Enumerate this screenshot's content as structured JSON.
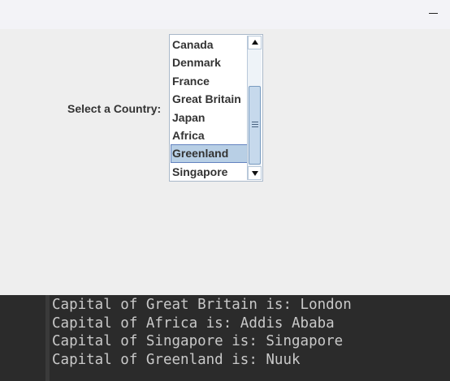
{
  "window": {
    "minimize_glyph": "—"
  },
  "form": {
    "label": "Select a Country:"
  },
  "country_list": {
    "items": [
      "Canada",
      "Denmark",
      "France",
      "Great Britain",
      "Japan",
      "Africa",
      "Greenland",
      "Singapore"
    ],
    "selected": "Greenland"
  },
  "console": {
    "lines": [
      "Capital of Great Britain is: London",
      "Capital of Africa is: Addis Ababa",
      "Capital of Singapore is: Singapore",
      "Capital of Greenland is: Nuuk"
    ]
  }
}
